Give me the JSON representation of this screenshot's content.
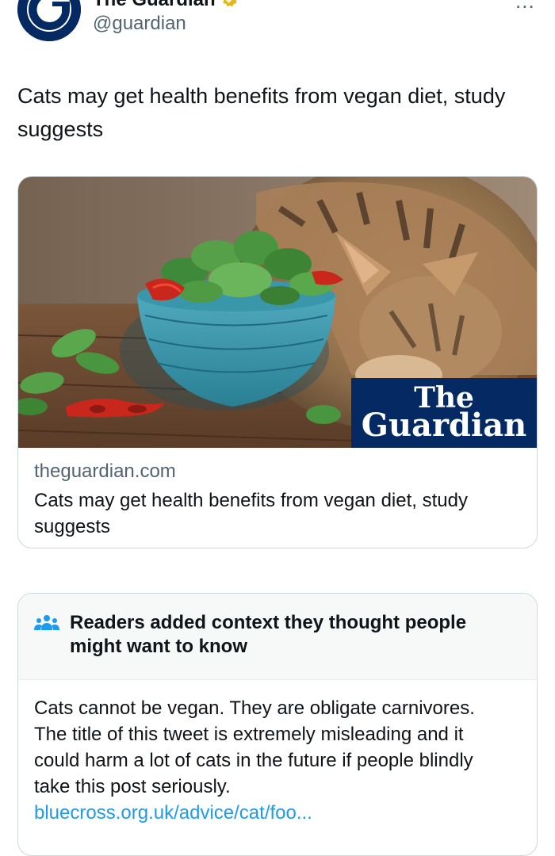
{
  "author": {
    "display_name": "The Guardian",
    "handle": "@guardian",
    "avatar_letter": "G",
    "verified_icon": "gold-verified-badge",
    "more_icon": "..."
  },
  "tweet": {
    "text": "Cats may get health benefits from vegan diet, study suggests"
  },
  "card": {
    "brand_the": "The",
    "brand_name": "Guardian",
    "domain": "theguardian.com",
    "title": "Cats may get health benefits from vegan diet, study suggests"
  },
  "community_note": {
    "icon": "people-icon",
    "heading": "Readers added context they thought people might want to know",
    "body": "Cats cannot be vegan. They are obligate carnivores. The title of this tweet is extremely misleading and it could harm a lot of cats in the future if people blindly take this post seriously.",
    "link": "bluecross.org.uk/advice/cat/foo..."
  },
  "colors": {
    "guardian_blue": "#052962",
    "link_blue": "#1d9bf0",
    "muted_text": "#536471",
    "verified_gold": "#e2b719"
  }
}
